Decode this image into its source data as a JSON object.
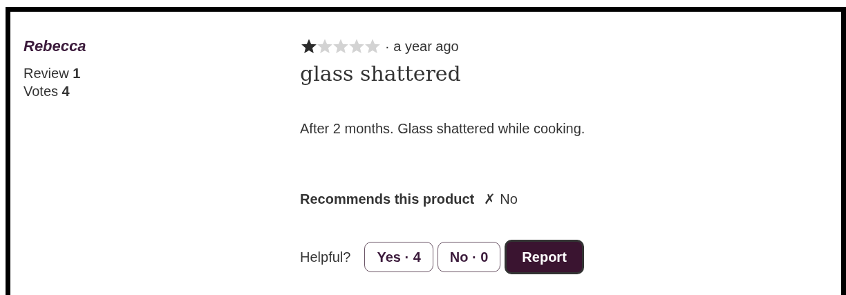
{
  "reviewer": {
    "name": "Rebecca",
    "stats": [
      "Review **1**",
      "Votes **4**"
    ]
  },
  "review": {
    "stars": 1,
    "time": "· a year ago",
    "title": "glass shattered",
    "body": "After 2 months. Glass shattered while cooking.",
    "recommend": {
      "label": "Recommends this product",
      "mark": "✗",
      "value": "No"
    },
    "helpful": {
      "label": "Helpful?",
      "buttons": [
        {
          "kind": "vote",
          "label": "Yes · 4"
        },
        {
          "kind": "vote",
          "label": "No · 0"
        },
        {
          "kind": "report",
          "label": "Report"
        }
      ]
    }
  }
}
